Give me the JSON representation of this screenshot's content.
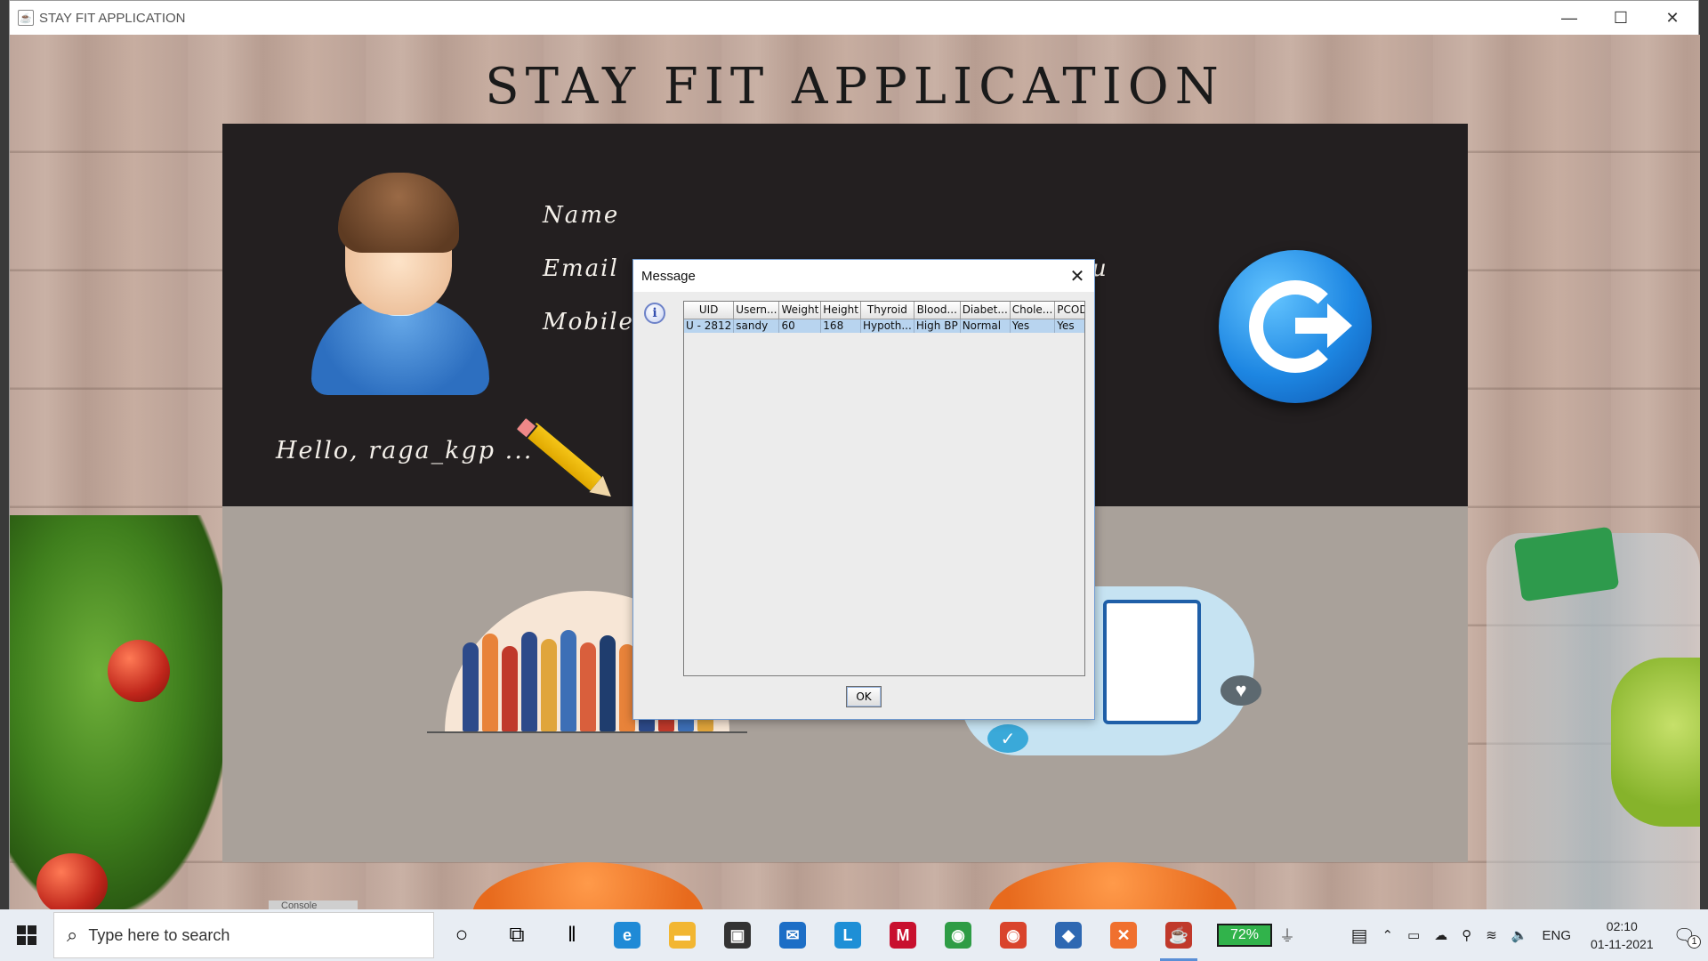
{
  "window": {
    "title": "STAY FIT APPLICATION",
    "controls": {
      "minimize": "—",
      "maximize": "☐",
      "close": "✕"
    }
  },
  "app": {
    "heading": "STAY FIT APPLICATION",
    "profile": {
      "name_label": "Name",
      "email_label": "Email",
      "mobile_label": "Mobile",
      "email_value_fragment": "u",
      "greeting": "Hello, raga_kgp ..."
    }
  },
  "dialog": {
    "title": "Message",
    "close": "✕",
    "info_glyph": "i",
    "table": {
      "headers": [
        "UID",
        "Usern...",
        "Weight",
        "Height",
        "Thyroid",
        "Blood...",
        "Diabet...",
        "Chole...",
        "PCOD"
      ],
      "rows": [
        [
          "U - 2812",
          "sandy",
          "60",
          "168",
          "Hypoth...",
          "High BP",
          "Normal",
          "Yes",
          "Yes"
        ]
      ]
    },
    "ok_label": "OK"
  },
  "taskbar": {
    "search_placeholder": "Type here to search",
    "battery": "72%",
    "language": "ENG",
    "time": "02:10",
    "date": "01-11-2021",
    "notification_count": "1",
    "background_text": "Console",
    "pinned": [
      {
        "name": "cortana-icon",
        "glyph": "○"
      },
      {
        "name": "task-view-icon",
        "glyph": "⧉"
      },
      {
        "name": "separator-icon",
        "glyph": "‖"
      },
      {
        "name": "edge-icon",
        "glyph": "e",
        "color": "#1f8ad6"
      },
      {
        "name": "file-explorer-icon",
        "glyph": "▬",
        "color": "#f2b632"
      },
      {
        "name": "store-icon",
        "glyph": "▣",
        "color": "#333333"
      },
      {
        "name": "mail-icon",
        "glyph": "✉",
        "color": "#1c6ec6"
      },
      {
        "name": "l-app-icon",
        "glyph": "L",
        "color": "#1e8fd6"
      },
      {
        "name": "mcafee-icon",
        "glyph": "M",
        "color": "#c8102e"
      },
      {
        "name": "chrome-icon",
        "glyph": "◉",
        "color": "#2e9c45"
      },
      {
        "name": "chrome-profile-icon",
        "glyph": "◉",
        "color": "#d9442c"
      },
      {
        "name": "virtualbox-icon",
        "glyph": "◆",
        "color": "#2e68b2"
      },
      {
        "name": "xampp-icon",
        "glyph": "✕",
        "color": "#f0702e"
      },
      {
        "name": "java-icon",
        "glyph": "☕",
        "color": "#c0392b"
      }
    ]
  },
  "colors": {
    "dark_panel": "#231f20",
    "light_panel": "#a9a19a",
    "selection": "#b8d4ef",
    "logout_blue": "#1d86e2"
  }
}
